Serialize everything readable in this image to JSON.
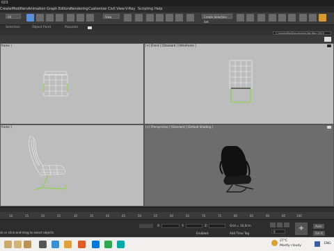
{
  "window": {
    "title": "023"
  },
  "menu": [
    "Create",
    "Modifiers",
    "Animation",
    "Graph Editors",
    "Rendering",
    "Customize",
    "Civil View",
    "V-Ray",
    "Scripting",
    "Help"
  ],
  "toolbar": {
    "filter_value": "All",
    "coord_value": "View",
    "selection_set_placeholder": "Create Selection Set"
  },
  "ribbon_tabs": [
    "Selection",
    "Object Paint",
    "Populate"
  ],
  "workspace_path": "C:\\Users\\Mo\\Documents\\3ds Max 2023",
  "viewports": {
    "top_left": {
      "label": "frame ]"
    },
    "top_right": {
      "label": "[+] [Front ] [Standard ] [Wireframe ]"
    },
    "bottom_left": {
      "label": "frame ]"
    },
    "bottom_right": {
      "label": "[+] [Perspective ] [Standard ] [Default Shading ]"
    }
  },
  "timeline": {
    "ticks": [
      "10",
      "15",
      "20",
      "25",
      "30",
      "35",
      "40",
      "45",
      "50",
      "55",
      "60",
      "65",
      "70",
      "75",
      "80",
      "85",
      "90",
      "95",
      "100"
    ]
  },
  "status": {
    "prompt": "ck or click-and-drag to select objects",
    "x_label": "X:",
    "y_label": "Y:",
    "z_label": "Z:",
    "grid": "Grid = 10,0cm",
    "enabled_label": "Enabled:",
    "add_time_tag": "Add Time Tag",
    "auto": "Auto",
    "set_k": "Set K",
    "key_value": "0"
  },
  "taskbar": {
    "weather_temp": "27°C",
    "weather_desc": "Mostly cloudy",
    "lang": "ENG"
  },
  "colors": {
    "accent": "#f0c040",
    "viewport_bg": "#bdbdbd",
    "perspective_bg": "#6d6d6d",
    "chair_frame": "#8fd14f"
  }
}
